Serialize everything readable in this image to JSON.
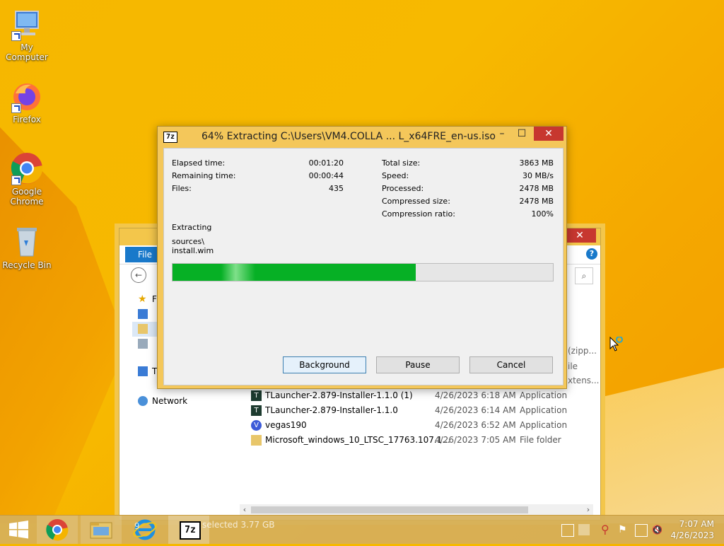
{
  "desktop": {
    "icons": [
      {
        "label": "My Computer"
      },
      {
        "label": "Firefox"
      },
      {
        "label": "Google Chrome"
      },
      {
        "label": "Recycle Bin"
      }
    ]
  },
  "explorer": {
    "file_tab": "File",
    "nav": [
      {
        "label": "F"
      },
      {
        "label": ""
      },
      {
        "label": ""
      },
      {
        "label": ""
      },
      {
        "label": "T"
      },
      {
        "label": "Network"
      }
    ],
    "col_fragments": [
      "(zipp...",
      "ile",
      "xtens..."
    ],
    "files": [
      {
        "name": "TLauncher-2.879-Installer-1.1.0 (1)",
        "date": "4/26/2023 6:18 AM",
        "type": "Application",
        "icon": "tlauncher-icon"
      },
      {
        "name": "TLauncher-2.879-Installer-1.1.0",
        "date": "4/26/2023 6:14 AM",
        "type": "Application",
        "icon": "tlauncher-icon"
      },
      {
        "name": "vegas190",
        "date": "4/26/2023 6:52 AM",
        "type": "Application",
        "icon": "vegas-icon"
      },
      {
        "name": "Microsoft_windows_10_LTSC_17763.107.1...",
        "date": "4/26/2023 7:05 AM",
        "type": "File folder",
        "icon": "folder-icon"
      }
    ],
    "status_selected": "selected  3.77 GB",
    "status_items": "9"
  },
  "dialog": {
    "title": "64% Extracting C:\\Users\\VM4.COLLA ... L_x64FRE_en-us.iso",
    "progress_percent": 64,
    "left_stats": [
      {
        "label": "Elapsed time:",
        "value": "00:01:20"
      },
      {
        "label": "Remaining time:",
        "value": "00:00:44"
      },
      {
        "label": "Files:",
        "value": "435"
      }
    ],
    "right_stats": [
      {
        "label": "Total size:",
        "value": "3863 MB"
      },
      {
        "label": "Speed:",
        "value": "30 MB/s"
      },
      {
        "label": "Processed:",
        "value": "2478 MB"
      },
      {
        "label": "Compressed size:",
        "value": "2478 MB"
      },
      {
        "label": "Compression ratio:",
        "value": "100%"
      }
    ],
    "status_label": "Extracting",
    "current_path": "sources\\",
    "current_file": "install.wim",
    "buttons": {
      "background": "Background",
      "pause": "Pause",
      "cancel": "Cancel"
    },
    "logo": "7z"
  },
  "taskbar": {
    "time": "7:07 AM",
    "date": "4/26/2023",
    "active_logo": "7z"
  },
  "colors": {
    "wallpaper": "#f6b700",
    "window_frame": "#f4c75a",
    "progress_fill": "#06b025",
    "close_red": "#c7372f",
    "accent_blue": "#1979ca"
  }
}
